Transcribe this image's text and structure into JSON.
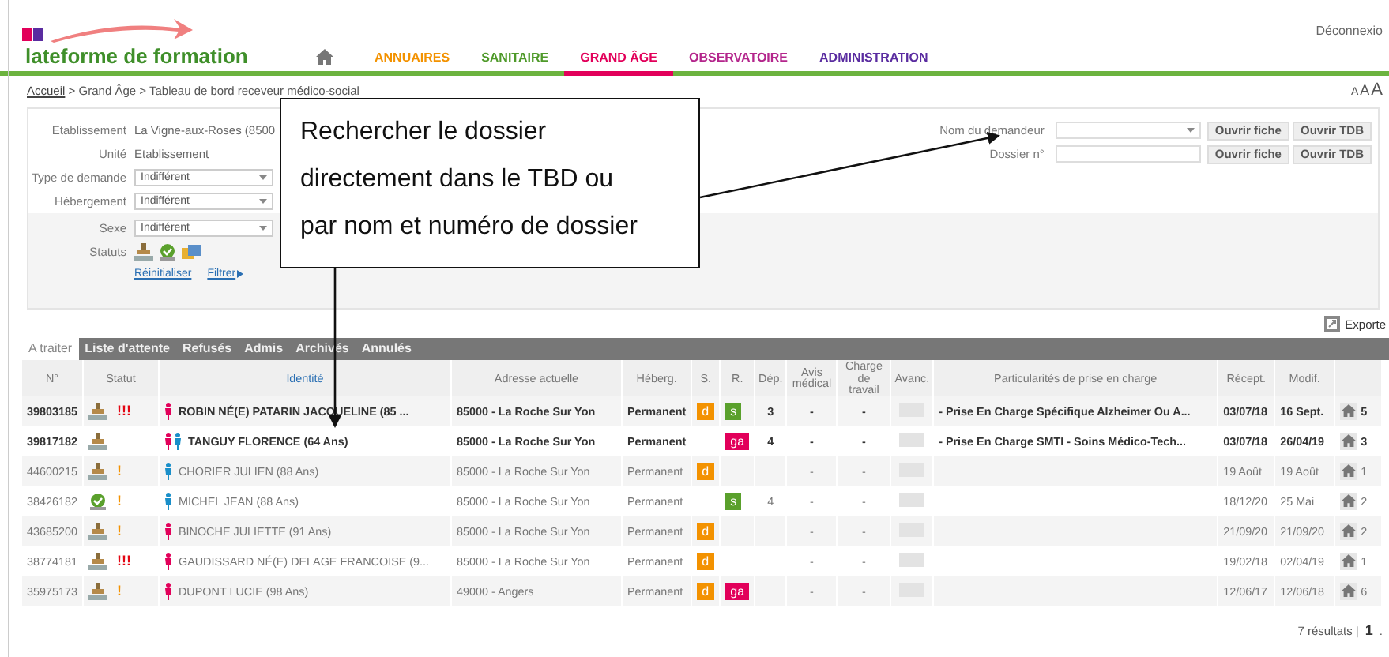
{
  "header": {
    "logout": "Déconnexio",
    "site_title": "lateforme de formation",
    "nav": [
      {
        "label": "ANNUAIRES",
        "color": "#f39200",
        "selected": false
      },
      {
        "label": "SANITAIRE",
        "color": "#4f9a2a",
        "selected": false
      },
      {
        "label": "GRAND ÂGE",
        "color": "#e2005a",
        "selected": true
      },
      {
        "label": "OBSERVATOIRE",
        "color": "#b4268c",
        "selected": false
      },
      {
        "label": "ADMINISTRATION",
        "color": "#5a2ca0",
        "selected": false
      }
    ]
  },
  "breadcrumb": {
    "items": [
      "Accueil",
      "Grand Âge",
      "Tableau de bord receveur médico-social"
    ],
    "separator": ">"
  },
  "text_size_control": [
    "A",
    "A",
    "A"
  ],
  "filters": {
    "upper": [
      {
        "label": "Etablissement",
        "kind": "text",
        "value": "La Vigne-aux-Roses (8500"
      },
      {
        "label": "Unité",
        "kind": "text",
        "value": "Etablissement"
      },
      {
        "label": "Type de demande",
        "kind": "select",
        "value": "Indifférent"
      },
      {
        "label": "Hébergement",
        "kind": "select",
        "value": "Indifférent"
      }
    ],
    "lower": [
      {
        "label": "Sexe",
        "kind": "select",
        "value": "Indifférent"
      }
    ],
    "statuts_label": "Statuts",
    "reset": "Réinitialiser",
    "filter": "Filtrer"
  },
  "search": [
    {
      "label": "Nom du demandeur",
      "kind": "combo",
      "buttons": [
        "Ouvrir fiche",
        "Ouvrir TDB"
      ]
    },
    {
      "label": "Dossier n°",
      "kind": "input",
      "buttons": [
        "Ouvrir fiche",
        "Ouvrir TDB"
      ]
    }
  ],
  "export": "Exporte",
  "tabs": [
    {
      "label": "A traiter",
      "selected": true
    },
    {
      "label": "Liste d'attente",
      "selected": false
    },
    {
      "label": "Refusés",
      "selected": false
    },
    {
      "label": "Admis",
      "selected": false
    },
    {
      "label": "Archivés",
      "selected": false
    },
    {
      "label": "Annulés",
      "selected": false
    }
  ],
  "columns": [
    {
      "label": "N°",
      "sorted": false
    },
    {
      "label": "Statut",
      "sorted": false
    },
    {
      "label": "Identité",
      "sorted": true
    },
    {
      "label": "Adresse actuelle",
      "sorted": false
    },
    {
      "label": "Héberg.",
      "sorted": false
    },
    {
      "label": "S.",
      "sorted": false
    },
    {
      "label": "R.",
      "sorted": false
    },
    {
      "label": "Dép.",
      "sorted": false
    },
    {
      "label": "Avis médical",
      "sorted": false
    },
    {
      "label": "Charge de travail",
      "sorted": false
    },
    {
      "label": "Avanc.",
      "sorted": false
    },
    {
      "label": "Particularités de prise en charge",
      "sorted": false
    },
    {
      "label": "Récept.",
      "sorted": false
    },
    {
      "label": "Modif.",
      "sorted": false
    }
  ],
  "rows": [
    {
      "number": "39803185",
      "bold": true,
      "status": {
        "kind": "stamp"
      },
      "alert": {
        "text": "!!!",
        "kind": "urgent"
      },
      "person": {
        "kind": "female"
      },
      "identity": "ROBIN NÉ(E) PATARIN JACQUELINE (85 ...",
      "address": "85000 - La Roche Sur Yon",
      "hebergement": "Permanent",
      "s": [
        {
          "label": "d",
          "color": "#f39200"
        }
      ],
      "r": [
        {
          "label": "s",
          "color": "#5aa02c"
        }
      ],
      "dep": "3",
      "avis": "-",
      "charge": "-",
      "particularites": "- Prise En Charge Spécifique Alzheimer Ou A...",
      "recept": "03/07/18",
      "modif": "16 Sept.",
      "count": "5"
    },
    {
      "number": "39817182",
      "bold": true,
      "status": {
        "kind": "stamp"
      },
      "person": {
        "kind": "couple"
      },
      "identity": "TANGUY FLORENCE (64 Ans)",
      "address": "85000 - La Roche Sur Yon",
      "hebergement": "Permanent",
      "r": [
        {
          "label": "ga",
          "color": "#e2005a"
        }
      ],
      "dep": "4",
      "avis": "-",
      "charge": "-",
      "particularites": "- Prise En Charge SMTI - Soins Médico-Tech...",
      "recept": "03/07/18",
      "modif": "26/04/19",
      "count": "3"
    },
    {
      "number": "44600215",
      "bold": false,
      "status": {
        "kind": "stamp"
      },
      "alert": {
        "text": "!",
        "kind": "warning"
      },
      "person": {
        "kind": "male"
      },
      "identity": "CHORIER JULIEN (88 Ans)",
      "address": "85000 - La Roche Sur Yon",
      "hebergement": "Permanent",
      "s": [
        {
          "label": "d",
          "color": "#f39200"
        }
      ],
      "avis": "-",
      "charge": "-",
      "recept": "19 Août",
      "modif": "19 Août",
      "count": "1"
    },
    {
      "number": "38426182",
      "bold": false,
      "status": {
        "kind": "check"
      },
      "alert": {
        "text": "!",
        "kind": "warning"
      },
      "person": {
        "kind": "male"
      },
      "identity": "MICHEL JEAN (88 Ans)",
      "address": "85000 - La Roche Sur Yon",
      "hebergement": "Permanent",
      "r": [
        {
          "label": "s",
          "color": "#5aa02c"
        }
      ],
      "dep": "4",
      "avis": "-",
      "charge": "-",
      "recept": "18/12/20",
      "modif": "25 Mai",
      "count": "2"
    },
    {
      "number": "43685200",
      "bold": false,
      "status": {
        "kind": "stamp"
      },
      "alert": {
        "text": "!",
        "kind": "warning"
      },
      "person": {
        "kind": "female"
      },
      "identity": "BINOCHE JULIETTE (91 Ans)",
      "address": "85000 - La Roche Sur Yon",
      "hebergement": "Permanent",
      "s": [
        {
          "label": "d",
          "color": "#f39200"
        }
      ],
      "avis": "-",
      "charge": "-",
      "recept": "21/09/20",
      "modif": "21/09/20",
      "count": "2"
    },
    {
      "number": "38774181",
      "bold": false,
      "status": {
        "kind": "stamp"
      },
      "alert": {
        "text": "!!!",
        "kind": "urgent"
      },
      "person": {
        "kind": "female"
      },
      "identity": "GAUDISSARD NÉ(E) DELAGE FRANCOISE (9...",
      "address": "85000 - La Roche Sur Yon",
      "hebergement": "Permanent",
      "s": [
        {
          "label": "d",
          "color": "#f39200"
        }
      ],
      "avis": "-",
      "charge": "-",
      "recept": "19/02/18",
      "modif": "02/04/19",
      "count": "1"
    },
    {
      "number": "35975173",
      "bold": false,
      "status": {
        "kind": "stamp"
      },
      "alert": {
        "text": "!",
        "kind": "warning"
      },
      "person": {
        "kind": "female"
      },
      "identity": "DUPONT LUCIE (98 Ans)",
      "address": "49000 - Angers",
      "hebergement": "Permanent",
      "s": [
        {
          "label": "d",
          "color": "#f39200"
        }
      ],
      "r": [
        {
          "label": "ga",
          "color": "#e2005a"
        }
      ],
      "avis": "-",
      "charge": "-",
      "recept": "12/06/17",
      "modif": "12/06/18",
      "count": "6"
    }
  ],
  "pagination": {
    "summary": "7 résultats |",
    "page": "1",
    "trailing": "."
  },
  "callout": {
    "lines": [
      "Rechercher le dossier",
      "directement dans le TBD ou",
      "par nom et numéro de dossier"
    ]
  }
}
